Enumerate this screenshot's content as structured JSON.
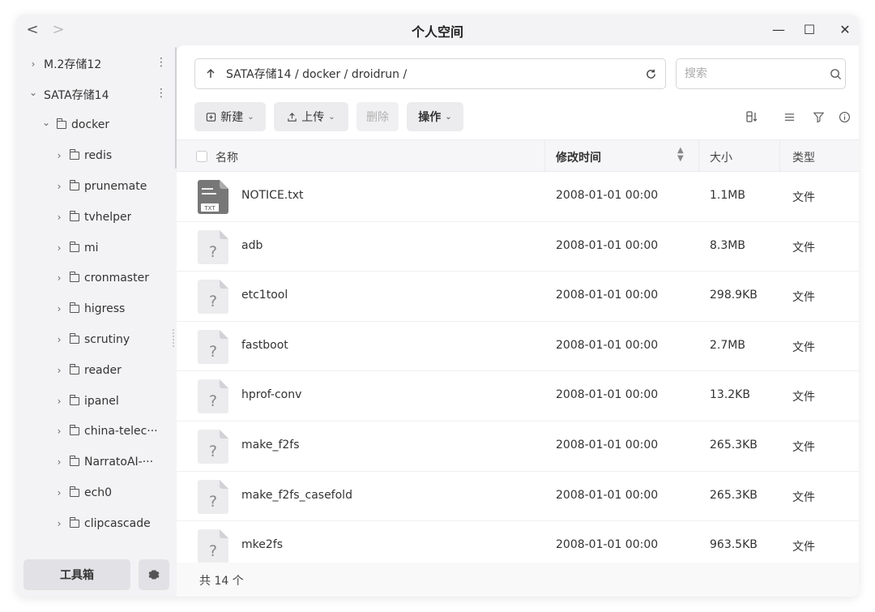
{
  "window": {
    "title": "个人空间"
  },
  "nav": {
    "back": "<",
    "forward": ">"
  },
  "controls": {
    "minimize": "—",
    "maximize": "☐",
    "close": "✕"
  },
  "sidebar": {
    "items": [
      {
        "label": "M.2存储12",
        "level": 0,
        "expanded": false,
        "folder": false
      },
      {
        "label": "SATA存储14",
        "level": 0,
        "expanded": true,
        "folder": false
      },
      {
        "label": "docker",
        "level": 1,
        "expanded": true,
        "folder": true
      },
      {
        "label": "redis",
        "level": 2,
        "expanded": false,
        "folder": true
      },
      {
        "label": "prunemate",
        "level": 2,
        "expanded": false,
        "folder": true
      },
      {
        "label": "tvhelper",
        "level": 2,
        "expanded": false,
        "folder": true
      },
      {
        "label": "mi",
        "level": 2,
        "expanded": false,
        "folder": true
      },
      {
        "label": "cronmaster",
        "level": 2,
        "expanded": false,
        "folder": true
      },
      {
        "label": "higress",
        "level": 2,
        "expanded": false,
        "folder": true
      },
      {
        "label": "scrutiny",
        "level": 2,
        "expanded": false,
        "folder": true
      },
      {
        "label": "reader",
        "level": 2,
        "expanded": false,
        "folder": true
      },
      {
        "label": "ipanel",
        "level": 2,
        "expanded": false,
        "folder": true
      },
      {
        "label": "china-telec···",
        "level": 2,
        "expanded": false,
        "folder": true
      },
      {
        "label": "NarratoAI-···",
        "level": 2,
        "expanded": false,
        "folder": true
      },
      {
        "label": "ech0",
        "level": 2,
        "expanded": false,
        "folder": true
      },
      {
        "label": "clipcascade",
        "level": 2,
        "expanded": false,
        "folder": true
      }
    ],
    "toolbox_label": "工具箱"
  },
  "pathbar": {
    "path": "SATA存储14 / docker / droidrun /"
  },
  "search": {
    "placeholder": "搜索"
  },
  "toolbar": {
    "new_label": "新建",
    "upload_label": "上传",
    "delete_label": "删除",
    "actions_label": "操作"
  },
  "table": {
    "headers": {
      "name": "名称",
      "modified": "修改时间",
      "size": "大小",
      "type": "类型"
    },
    "rows": [
      {
        "name": "NOTICE.txt",
        "modified": "2008-01-01 00:00",
        "size": "1.1MB",
        "type": "文件",
        "icon": "txt-file-icon",
        "badge": "TXT"
      },
      {
        "name": "adb",
        "modified": "2008-01-01 00:00",
        "size": "8.3MB",
        "type": "文件",
        "icon": "unknown-file-icon"
      },
      {
        "name": "etc1tool",
        "modified": "2008-01-01 00:00",
        "size": "298.9KB",
        "type": "文件",
        "icon": "unknown-file-icon"
      },
      {
        "name": "fastboot",
        "modified": "2008-01-01 00:00",
        "size": "2.7MB",
        "type": "文件",
        "icon": "unknown-file-icon"
      },
      {
        "name": "hprof-conv",
        "modified": "2008-01-01 00:00",
        "size": "13.2KB",
        "type": "文件",
        "icon": "unknown-file-icon"
      },
      {
        "name": "make_f2fs",
        "modified": "2008-01-01 00:00",
        "size": "265.3KB",
        "type": "文件",
        "icon": "unknown-file-icon"
      },
      {
        "name": "make_f2fs_casefold",
        "modified": "2008-01-01 00:00",
        "size": "265.3KB",
        "type": "文件",
        "icon": "unknown-file-icon"
      },
      {
        "name": "mke2fs",
        "modified": "2008-01-01 00:00",
        "size": "963.5KB",
        "type": "文件",
        "icon": "unknown-file-icon"
      }
    ]
  },
  "footer": {
    "count": "共 14 个"
  },
  "colors": {
    "window_bg": "#f3f3f5",
    "panel_bg": "#ffffff",
    "button_bg": "#ececef",
    "text": "#333333"
  }
}
